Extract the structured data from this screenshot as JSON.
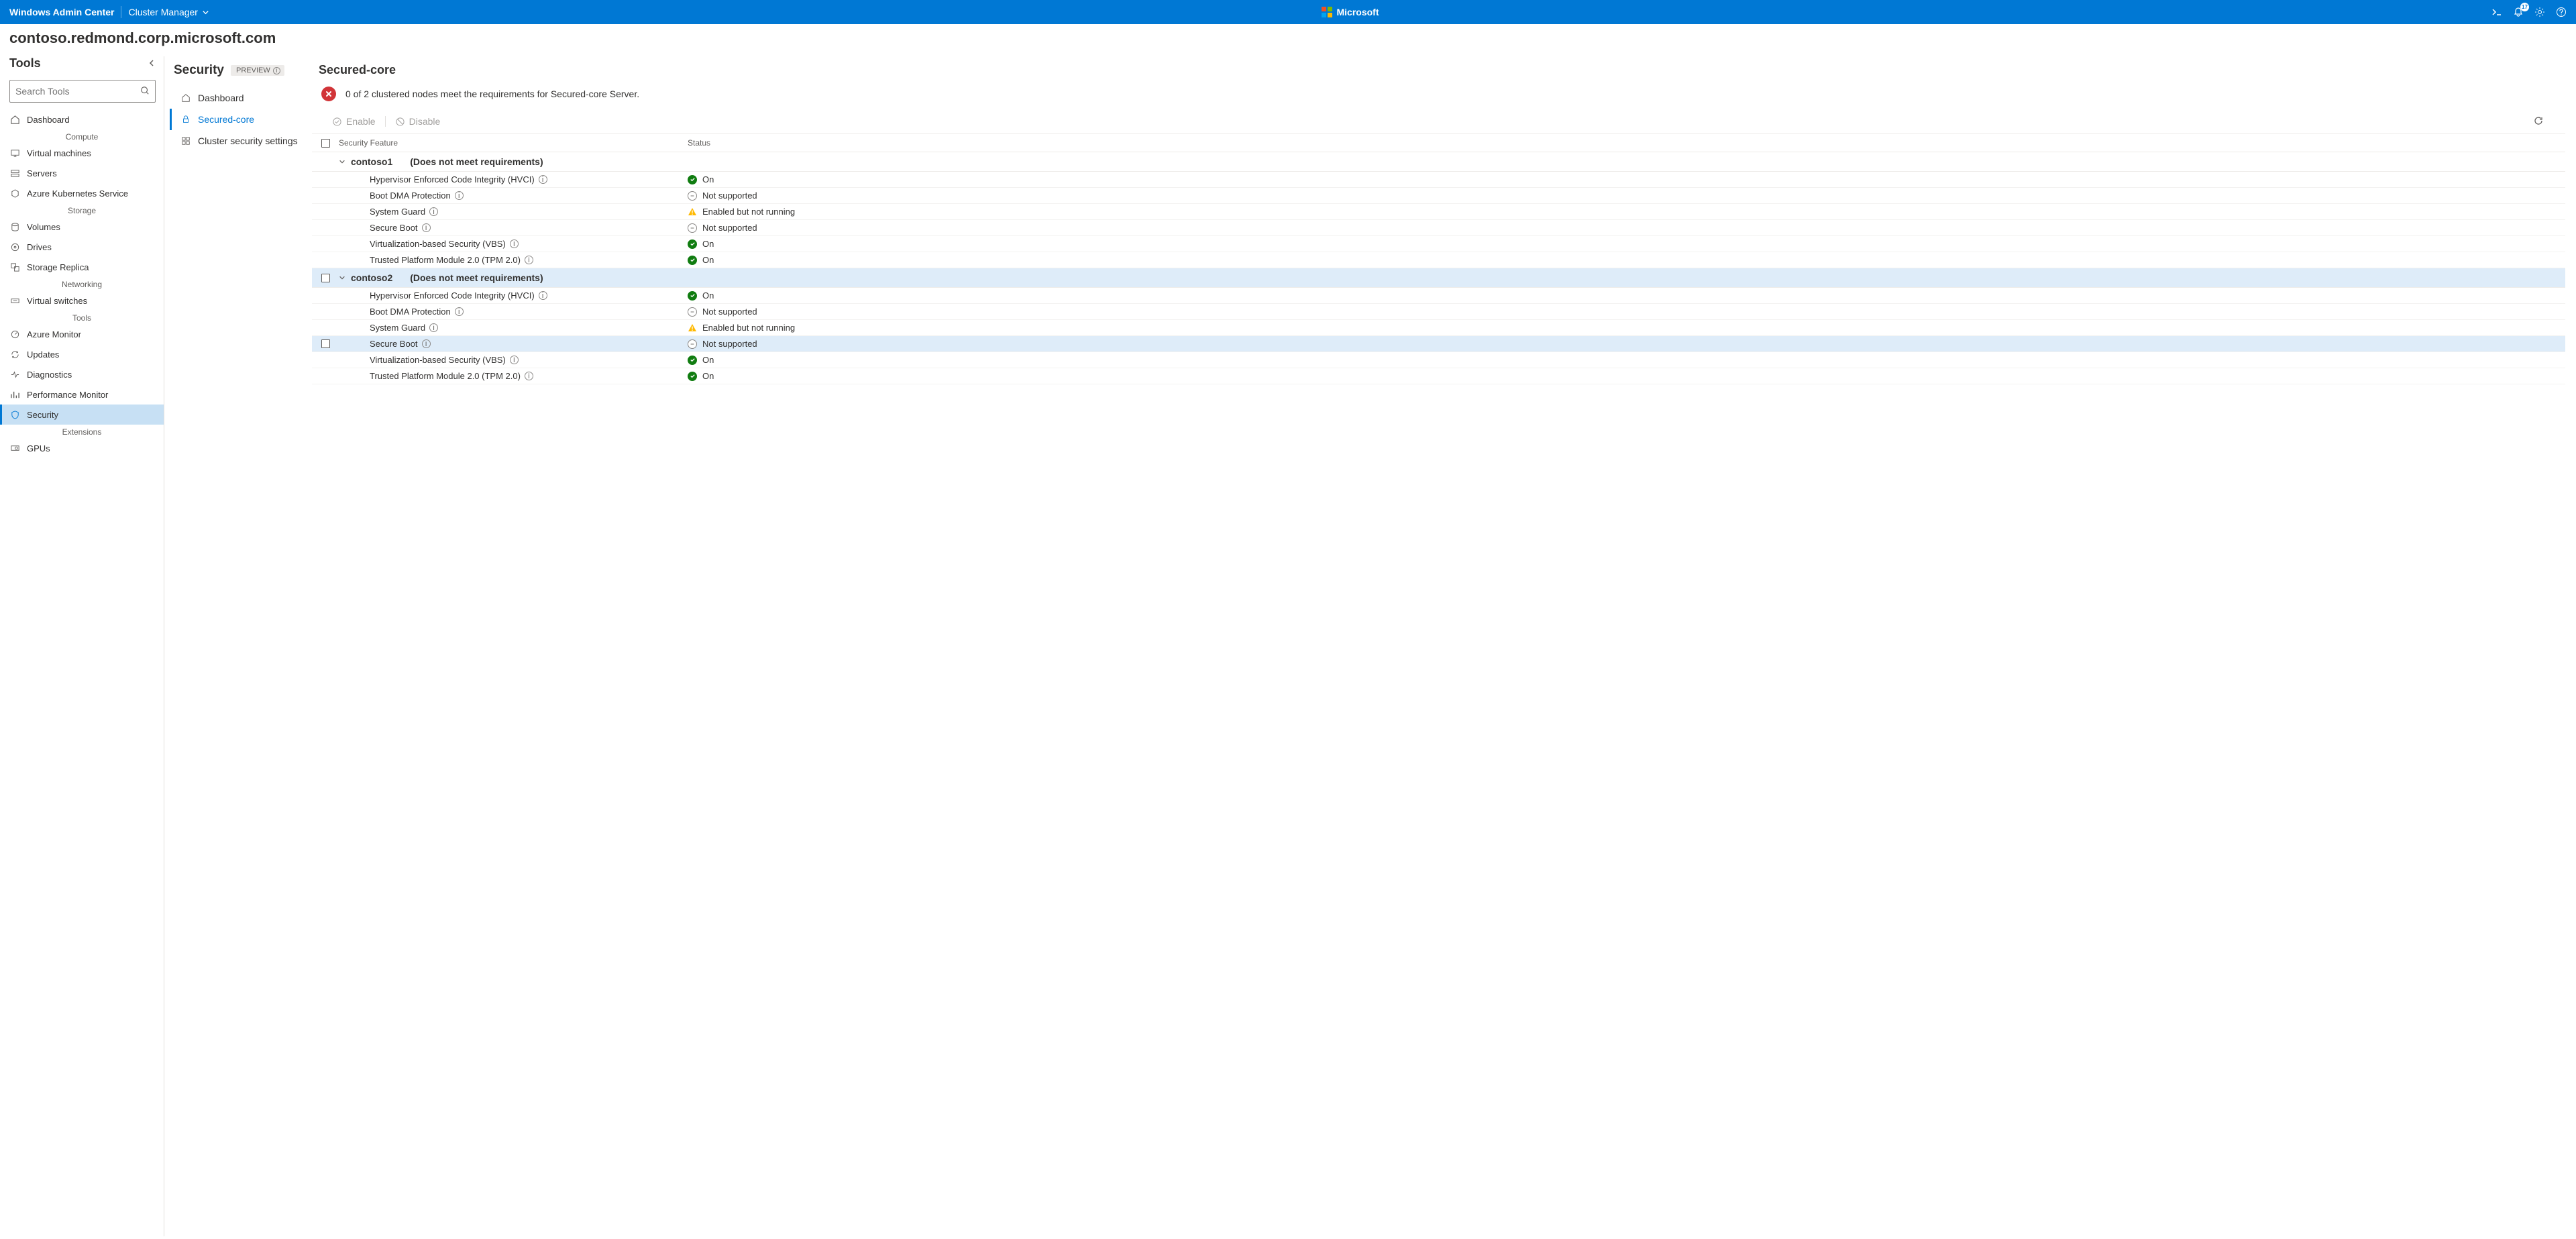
{
  "topbar": {
    "app": "Windows Admin Center",
    "context": "Cluster Manager",
    "brand": "Microsoft",
    "notif_count": "17"
  },
  "breadcrumb": "contoso.redmond.corp.microsoft.com",
  "sidebar": {
    "title": "Tools",
    "search_placeholder": "Search Tools",
    "sections": {
      "compute": "Compute",
      "storage": "Storage",
      "networking": "Networking",
      "tools": "Tools",
      "extensions": "Extensions"
    },
    "items": {
      "dashboard": "Dashboard",
      "vms": "Virtual machines",
      "servers": "Servers",
      "aks": "Azure Kubernetes Service",
      "volumes": "Volumes",
      "drives": "Drives",
      "replica": "Storage Replica",
      "vswitches": "Virtual switches",
      "azmon": "Azure Monitor",
      "updates": "Updates",
      "diag": "Diagnostics",
      "perfmon": "Performance Monitor",
      "security": "Security",
      "gpus": "GPUs"
    }
  },
  "subnav": {
    "title": "Security",
    "preview": "PREVIEW",
    "items": {
      "dash": "Dashboard",
      "sc": "Secured-core",
      "css": "Cluster security settings"
    }
  },
  "content": {
    "title": "Secured-core",
    "banner": "0 of 2 clustered nodes meet the requirements for Secured-core Server.",
    "actions": {
      "enable": "Enable",
      "disable": "Disable"
    },
    "cols": {
      "feature": "Security Feature",
      "status": "Status"
    },
    "groups": [
      {
        "name": "contoso1",
        "status": "(Does not meet requirements)",
        "selected": false
      },
      {
        "name": "contoso2",
        "status": "(Does not meet requirements)",
        "selected": true
      }
    ],
    "features": {
      "hvci": "Hypervisor Enforced Code Integrity (HVCI)",
      "bdma": "Boot DMA Protection",
      "sg": "System Guard",
      "sb": "Secure Boot",
      "vbs": "Virtualization-based Security (VBS)",
      "tpm": "Trusted Platform Module 2.0 (TPM 2.0)"
    },
    "statuses": {
      "on": "On",
      "ns": "Not supported",
      "warn": "Enabled but not running"
    }
  }
}
